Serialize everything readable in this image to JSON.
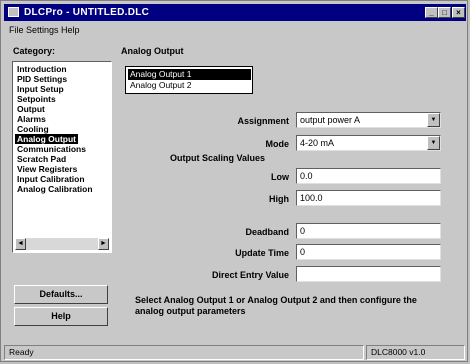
{
  "window": {
    "title": "DLCPro - UNTITLED.DLC"
  },
  "menu": [
    "File",
    "Settings",
    "Help"
  ],
  "category": {
    "label": "Category:",
    "items": [
      "Introduction",
      "PID Settings",
      "Input Setup",
      "Setpoints",
      "Output",
      "Alarms",
      "Cooling",
      "Analog Output",
      "Communications",
      "Scratch Pad",
      "View Registers",
      "Input Calibration",
      "Analog Calibration"
    ],
    "selected_index": 7
  },
  "buttons": {
    "defaults": "Defaults...",
    "help": "Help"
  },
  "panel": {
    "title": "Analog Output",
    "outputs": [
      "Analog Output 1",
      "Analog Output 2"
    ],
    "selected_output": 0,
    "assignment_label": "Assignment",
    "assignment_value": "output power A",
    "mode_label": "Mode",
    "mode_value": "4-20 mA",
    "scaling_label": "Output Scaling Values",
    "low_label": "Low",
    "low_value": "0.0",
    "high_label": "High",
    "high_value": "100.0",
    "deadband_label": "Deadband",
    "deadband_value": "0",
    "update_label": "Update Time",
    "update_value": "0",
    "direct_label": "Direct Entry Value",
    "direct_value": "",
    "instructions": "Select Analog Output 1 or Analog Output 2 and then configure the analog output parameters"
  },
  "status": {
    "left": "Ready",
    "right": "DLC8000 v1.0"
  },
  "colors": {
    "titlebar": "#000080",
    "selection": "#000000",
    "face": "#c8c8c8"
  }
}
